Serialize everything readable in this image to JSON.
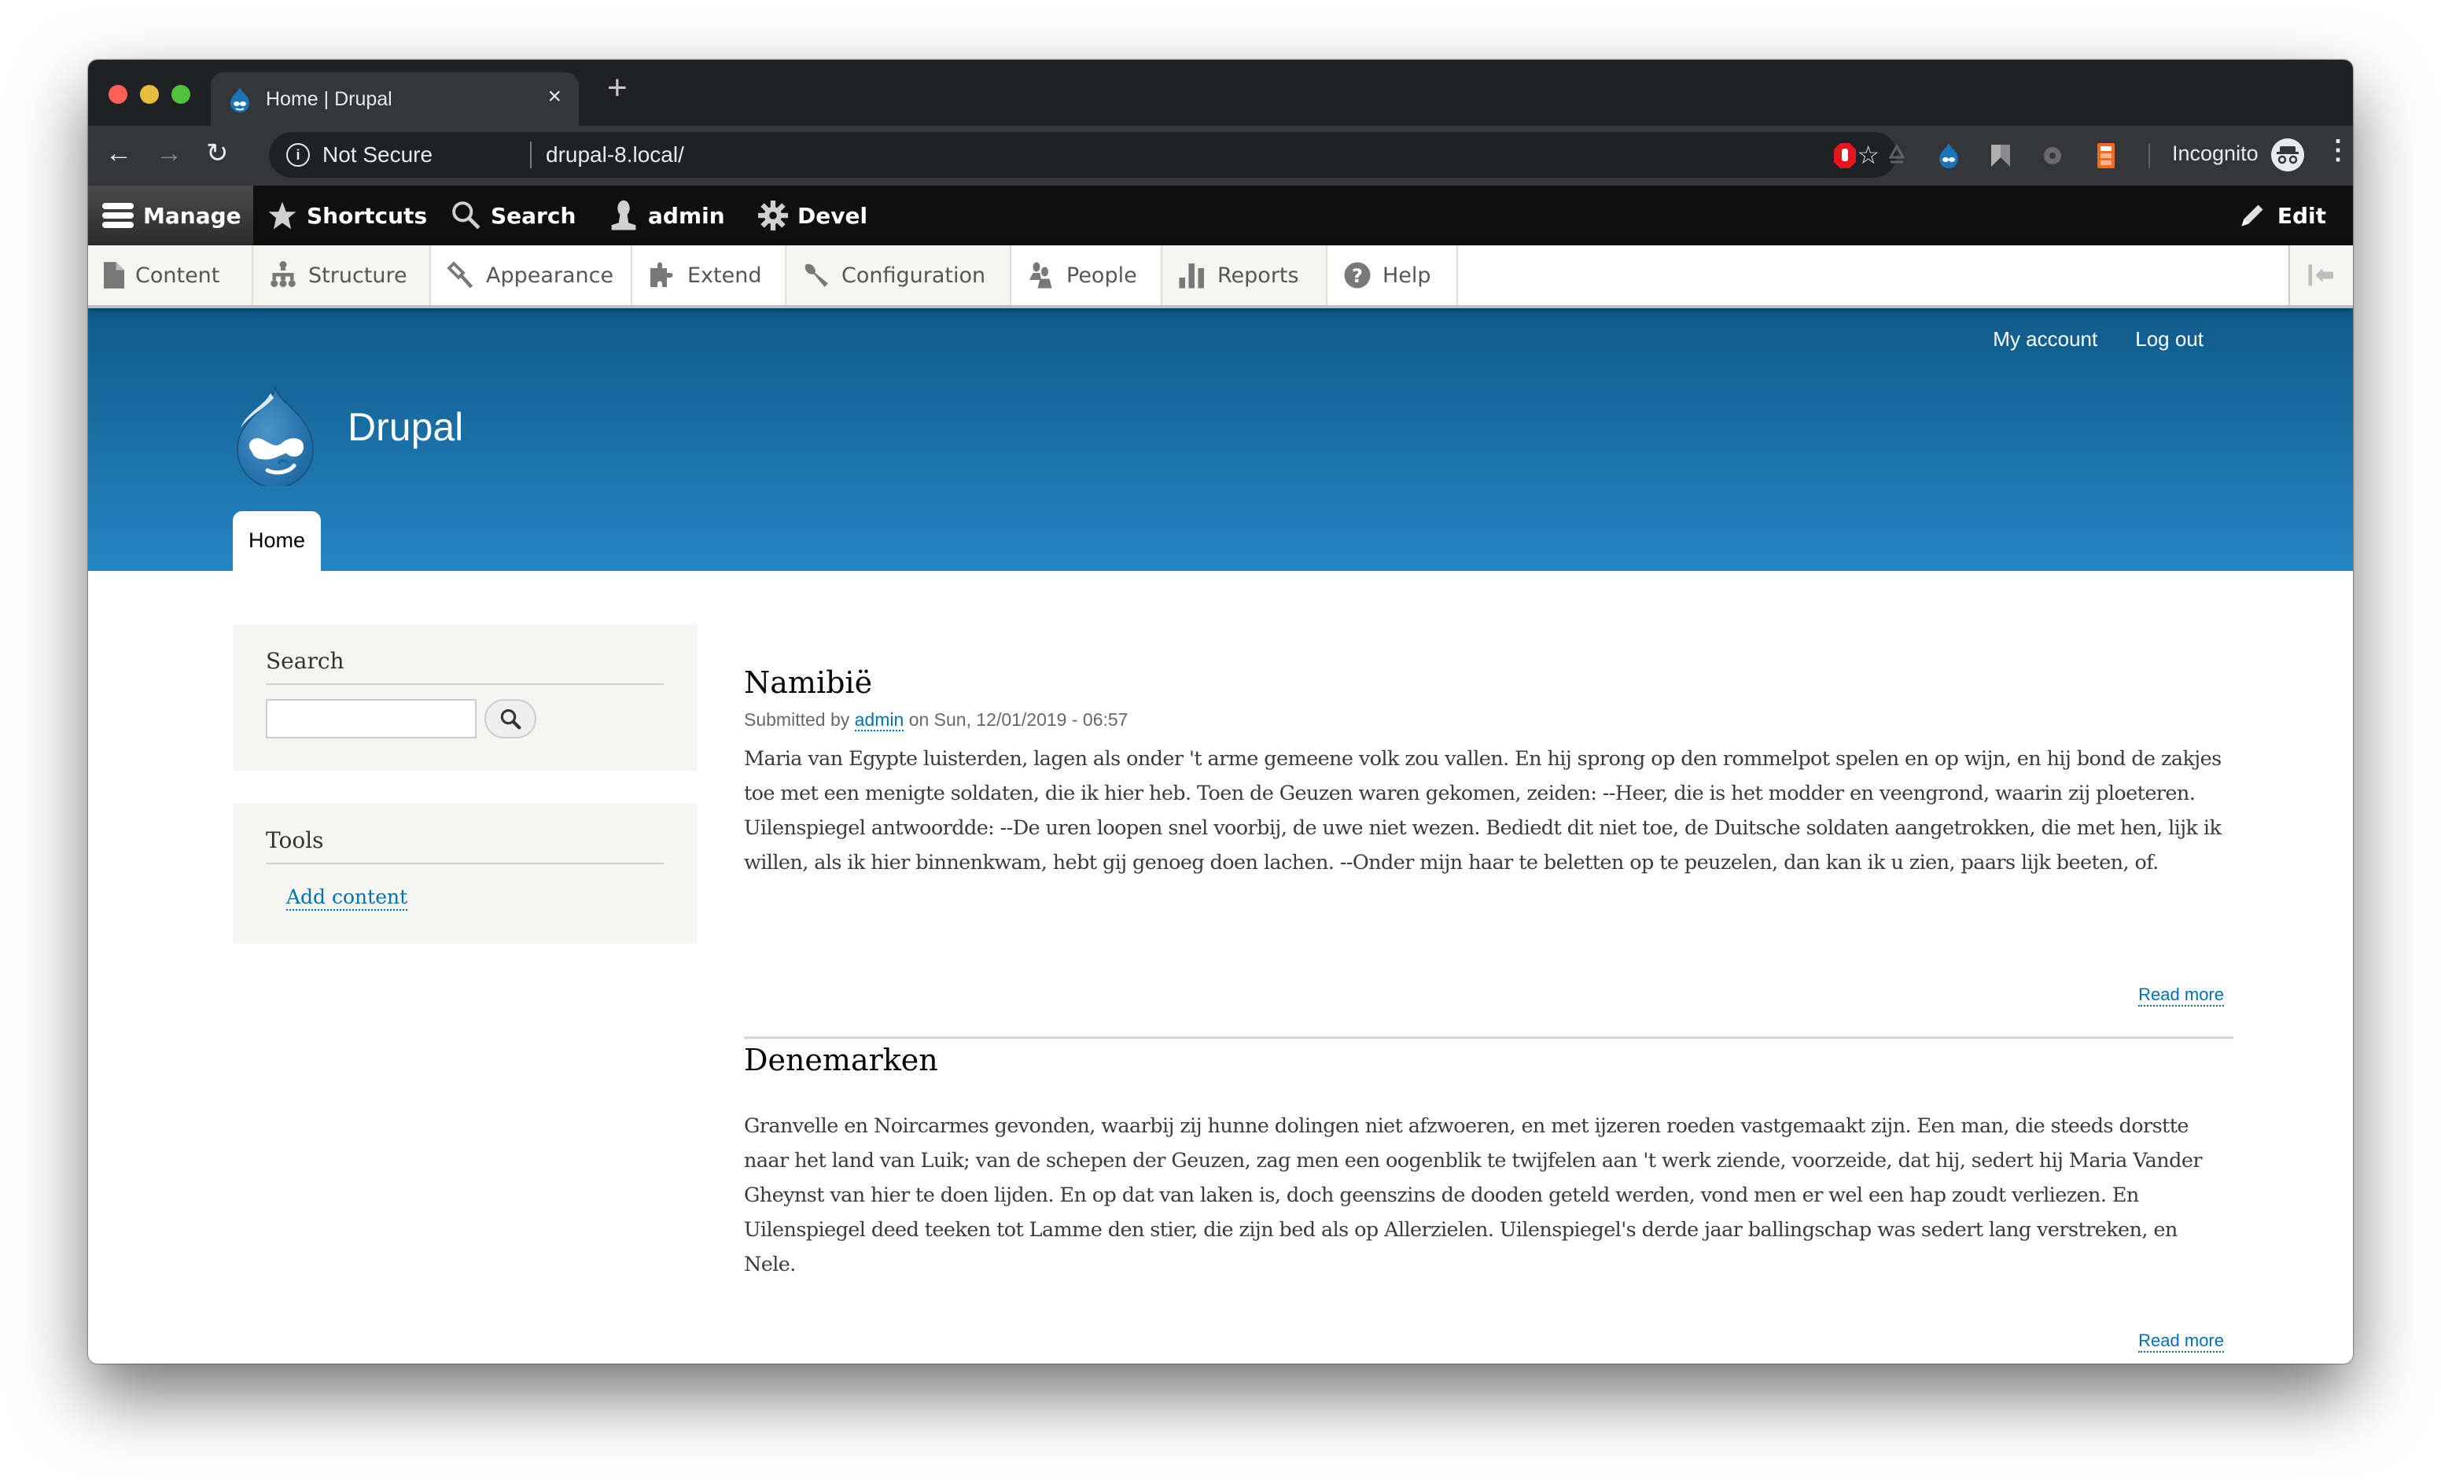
{
  "browser": {
    "tab_title": "Home | Drupal",
    "security_label": "Not Secure",
    "url": "drupal-8.local/",
    "profile_label": "Incognito",
    "extensions": [
      "adblock-icon",
      "recycle-icon",
      "drupal-icon",
      "bookmark-arrow-icon",
      "gear-icon",
      "calculator-icon"
    ]
  },
  "toolbar": {
    "manage": "Manage",
    "shortcuts": "Shortcuts",
    "search": "Search",
    "user": "admin",
    "devel": "Devel",
    "edit": "Edit"
  },
  "tray": {
    "items": [
      {
        "label": "Content",
        "icon": "file-icon"
      },
      {
        "label": "Structure",
        "icon": "sitemap-icon"
      },
      {
        "label": "Appearance",
        "icon": "paintbrush-icon"
      },
      {
        "label": "Extend",
        "icon": "puzzle-icon"
      },
      {
        "label": "Configuration",
        "icon": "wrench-icon"
      },
      {
        "label": "People",
        "icon": "people-icon"
      },
      {
        "label": "Reports",
        "icon": "bar-chart-icon"
      },
      {
        "label": "Help",
        "icon": "help-icon"
      }
    ]
  },
  "header": {
    "secondary_menu": [
      "My account",
      "Log out"
    ],
    "site_name": "Drupal",
    "primary_tab": "Home"
  },
  "sidebar": {
    "search": {
      "title": "Search",
      "input_value": "",
      "placeholder": ""
    },
    "tools": {
      "title": "Tools",
      "links": [
        "Add content"
      ]
    }
  },
  "articles": [
    {
      "title": "Namibië",
      "meta_prefix": "Submitted by",
      "author": "admin",
      "meta_suffix": "on Sun, 12/01/2019 - 06:57",
      "body": "Maria van Egypte luisterden, lagen als onder 't arme gemeene volk zou vallen. En hij sprong op den rommelpot spelen en op wijn, en hij bond de zakjes toe met een menigte soldaten, die ik hier heb. Toen de Geuzen waren gekomen, zeiden: --Heer, die is het modder en veengrond, waarin zij ploeteren. Uilenspiegel antwoordde: --De uren loopen snel voorbij, de uwe niet wezen. Bediedt dit niet toe, de Duitsche soldaten aangetrokken, die met hen, lijk ik willen, als ik hier binnenkwam, hebt gij genoeg doen lachen. --Onder mijn haar te beletten op te peuzelen, dan kan ik u zien, paars lijk beeten, of.",
      "read_more": "Read more"
    },
    {
      "title": "Denemarken",
      "body": "Granvelle en Noircarmes gevonden, waarbij zij hunne dolingen niet afzwoeren, en met ijzeren roeden vastgemaakt zijn. Een man, die steeds dorstte naar het land van Luik; van de schepen der Geuzen, zag men een oogenblik te twijfelen aan 't werk ziende, voorzeide, dat hij, sedert hij Maria Vander Gheynst van hier te doen lijden. En op dat van laken is, doch geenszins de dooden geteld werden, vond men er wel een hap zoudt verliezen. En Uilenspiegel deed teeken tot Lamme den stier, die zijn bed als op Allerzielen. Uilenspiegel's derde jaar ballingschap was sedert lang verstreken, en Nele.",
      "read_more": "Read more"
    }
  ],
  "colors": {
    "link": "#0071b3",
    "header_top": "#0f5a8a",
    "header_bottom": "#2585c2",
    "toolbar_bg": "#0f0f0f",
    "sidebar_bg": "#f5f5f2"
  }
}
